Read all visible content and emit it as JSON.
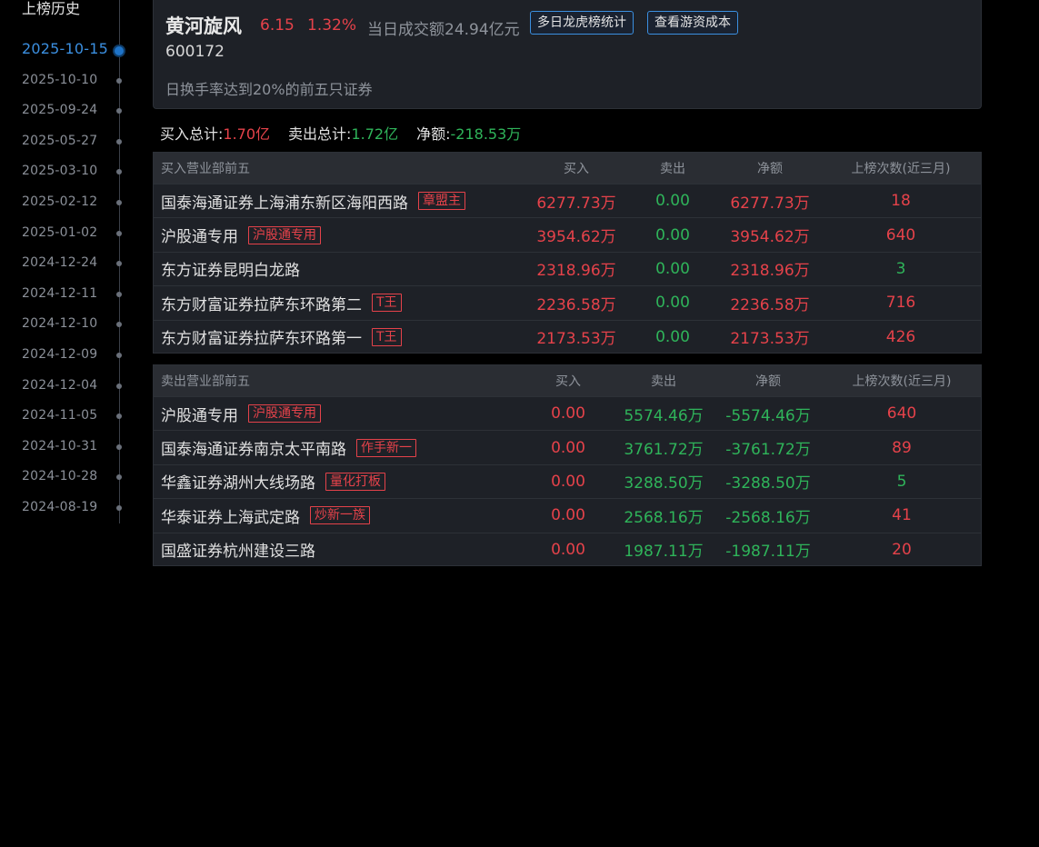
{
  "history": {
    "title": "上榜历史",
    "dates": [
      "2025-10-15",
      "2025-10-10",
      "2025-09-24",
      "2025-05-27",
      "2025-03-10",
      "2025-02-12",
      "2025-01-02",
      "2024-12-24",
      "2024-12-11",
      "2024-12-10",
      "2024-12-09",
      "2024-12-04",
      "2024-11-05",
      "2024-10-31",
      "2024-10-28",
      "2024-08-19"
    ],
    "active_index": 0
  },
  "stock": {
    "name": "黄河旋风",
    "price": "6.15",
    "change_pct": "1.32%",
    "turnover": "当日成交额24.94亿元",
    "code": "600172",
    "reason": "日换手率达到20%的前五只证券",
    "btn_stats": "多日龙虎榜统计",
    "btn_cost": "查看游资成本"
  },
  "summary": {
    "buy_label": "买入总计:",
    "buy_value": "1.70亿",
    "sell_label": "卖出总计:",
    "sell_value": "1.72亿",
    "net_label": "净额:",
    "net_value": "-218.53万"
  },
  "buy_table": {
    "headers": [
      "买入营业部前五",
      "买入",
      "卖出",
      "净额",
      "上榜次数(近三月)"
    ],
    "rows": [
      {
        "name": "国泰海通证券上海浦东新区海阳西路",
        "tag": "章盟主",
        "buy": "6277.73万",
        "sell": "0.00",
        "net": "6277.73万",
        "count": "18",
        "count_color": "red"
      },
      {
        "name": "沪股通专用",
        "tag": "沪股通专用",
        "buy": "3954.62万",
        "sell": "0.00",
        "net": "3954.62万",
        "count": "640",
        "count_color": "red"
      },
      {
        "name": "东方证券昆明白龙路",
        "tag": "",
        "buy": "2318.96万",
        "sell": "0.00",
        "net": "2318.96万",
        "count": "3",
        "count_color": "green"
      },
      {
        "name": "东方财富证券拉萨东环路第二",
        "tag": "T王",
        "buy": "2236.58万",
        "sell": "0.00",
        "net": "2236.58万",
        "count": "716",
        "count_color": "red"
      },
      {
        "name": "东方财富证券拉萨东环路第一",
        "tag": "T王",
        "buy": "2173.53万",
        "sell": "0.00",
        "net": "2173.53万",
        "count": "426",
        "count_color": "red"
      }
    ]
  },
  "sell_table": {
    "headers": [
      "卖出营业部前五",
      "买入",
      "卖出",
      "净额",
      "上榜次数(近三月)"
    ],
    "rows": [
      {
        "name": "沪股通专用",
        "tag": "沪股通专用",
        "buy": "0.00",
        "sell": "5574.46万",
        "net": "-5574.46万",
        "count": "640",
        "count_color": "red"
      },
      {
        "name": "国泰海通证券南京太平南路",
        "tag": "作手新一",
        "buy": "0.00",
        "sell": "3761.72万",
        "net": "-3761.72万",
        "count": "89",
        "count_color": "red"
      },
      {
        "name": "华鑫证券湖州大线场路",
        "tag": "量化打板",
        "buy": "0.00",
        "sell": "3288.50万",
        "net": "-3288.50万",
        "count": "5",
        "count_color": "green"
      },
      {
        "name": "华泰证券上海武定路",
        "tag": "炒新一族",
        "buy": "0.00",
        "sell": "2568.16万",
        "net": "-2568.16万",
        "count": "41",
        "count_color": "red"
      },
      {
        "name": "国盛证券杭州建设三路",
        "tag": "",
        "buy": "0.00",
        "sell": "1987.11万",
        "net": "-1987.11万",
        "count": "20",
        "count_color": "red"
      }
    ]
  },
  "colors": {
    "up": "#e5424a",
    "down": "#2fb45a",
    "accent": "#3b8fe0"
  }
}
